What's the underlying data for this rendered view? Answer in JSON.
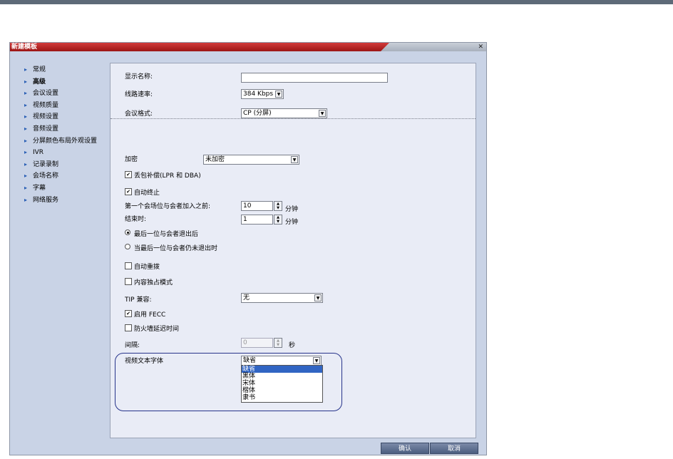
{
  "dialog": {
    "title": "新建模板",
    "close_icon": "close-icon"
  },
  "nav": {
    "items": [
      {
        "label": "常规",
        "selected": false
      },
      {
        "label": "高级",
        "selected": true
      },
      {
        "label": "会议设置",
        "selected": false
      },
      {
        "label": "视频质量",
        "selected": false
      },
      {
        "label": "视频设置",
        "selected": false
      },
      {
        "label": "音频设置",
        "selected": false
      },
      {
        "label": "分屏颜色布局外观设置",
        "selected": false
      },
      {
        "label": "IVR",
        "selected": false
      },
      {
        "label": "记录录制",
        "selected": false
      },
      {
        "label": "会场名称",
        "selected": false
      },
      {
        "label": "字幕",
        "selected": false
      },
      {
        "label": "网络服务",
        "selected": false
      }
    ]
  },
  "form": {
    "display_name_label": "显示名称:",
    "display_name_value": "",
    "line_rate_label": "线路速率:",
    "line_rate_value": "384 Kbps",
    "conference_format_label": "会议格式:",
    "conference_format_value": "CP (分屏)",
    "encryption_label": "加密",
    "encryption_value": "未加密",
    "lpr_label": "丢包补偿(LPR 和 DBA)",
    "lpr_checked": true,
    "auto_terminate_label": "自动终止",
    "auto_terminate_checked": true,
    "before_first_join_label": "第一个会场位与会者加入之前:",
    "before_first_join_value": "10",
    "before_first_join_unit": "分钟",
    "at_end_label": "结束时:",
    "at_end_value": "1",
    "at_end_unit": "分钟",
    "radio_last_leave_label": "最后一位与会者退出后",
    "radio_last_leave_on": true,
    "radio_only_one_label": "当最后一位与会者仍未退出时",
    "radio_only_one_on": false,
    "auto_redial_label": "自动重拨",
    "auto_redial_checked": false,
    "content_exclusive_label": "内容独占模式",
    "content_exclusive_checked": false,
    "tip_label": "TIP 兼容:",
    "tip_value": "无",
    "fecc_label": "启用 FECC",
    "fecc_checked": true,
    "firewall_label": "防火墙延迟时间",
    "firewall_checked": false,
    "interval_label": "间隔:",
    "interval_value": "0",
    "interval_unit": "秒",
    "video_font_label": "视频文本字体",
    "video_font_value": "缺省",
    "video_font_options": [
      "缺省",
      "黑体",
      "宋体",
      "楷体",
      "隶书"
    ],
    "video_font_selected_index": 0
  },
  "footer": {
    "ok_label": "确认",
    "cancel_label": "取消"
  },
  "colors": {
    "title_bar": "#b52323",
    "dialog_bg": "#c9d3e6",
    "panel_bg": "#e9ecf6",
    "highlight": "#27348b",
    "list_selected": "#3165c3"
  }
}
